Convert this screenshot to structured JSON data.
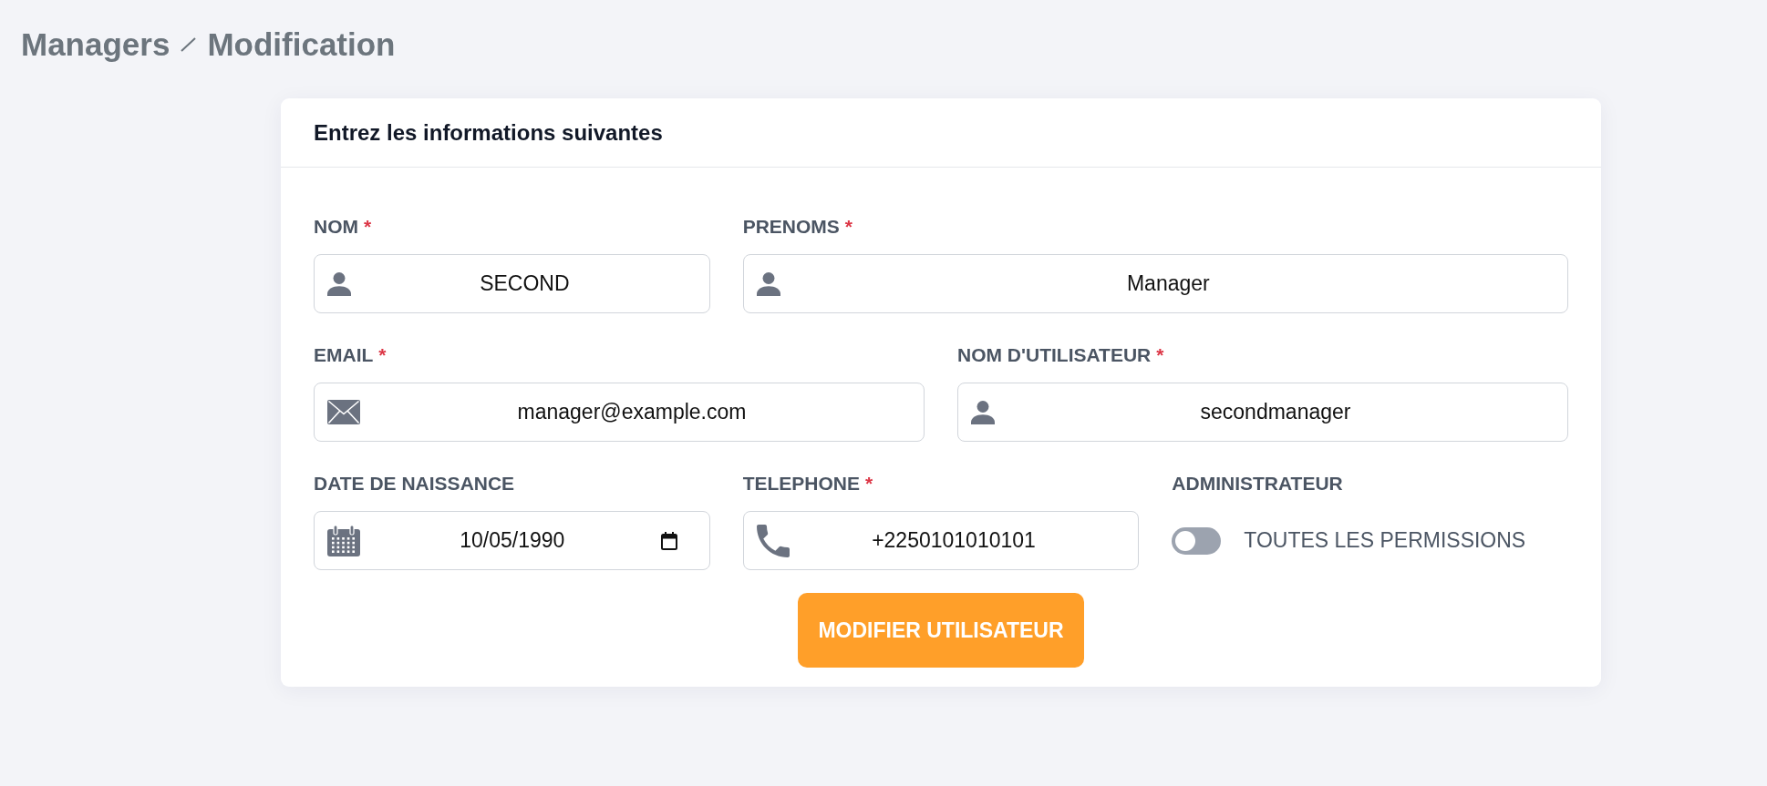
{
  "breadcrumb": {
    "parent": "Managers",
    "current": "Modification"
  },
  "card": {
    "title": "Entrez les informations suivantes",
    "rows": [
      {
        "fields": [
          {
            "kind": "text",
            "label": "NOM",
            "required_mark": "*",
            "value": "SECOND"
          },
          {
            "kind": "text",
            "label": "PRENOMS",
            "required_mark": "*",
            "value": "Manager"
          }
        ]
      },
      {
        "fields": [
          {
            "kind": "email",
            "label": "EMAIL",
            "required_mark": "*",
            "value": "manager@example.com"
          },
          {
            "kind": "text",
            "label": "NOM D'UTILISATEUR",
            "required_mark": "*",
            "value": "secondmanager"
          }
        ]
      },
      {
        "fields": [
          {
            "kind": "date",
            "label": "DATE DE NAISSANCE",
            "value": "10/05/1990"
          },
          {
            "kind": "tel",
            "label": "TELEPHONE",
            "required_mark": "*",
            "value": "+2250101010101"
          },
          {
            "kind": "toggle",
            "label": "ADMINISTRATEUR",
            "option": "TOUTES LES PERMISSIONS",
            "on": false
          }
        ]
      }
    ],
    "submit_button": "MODIFIER UTILISATEUR"
  }
}
